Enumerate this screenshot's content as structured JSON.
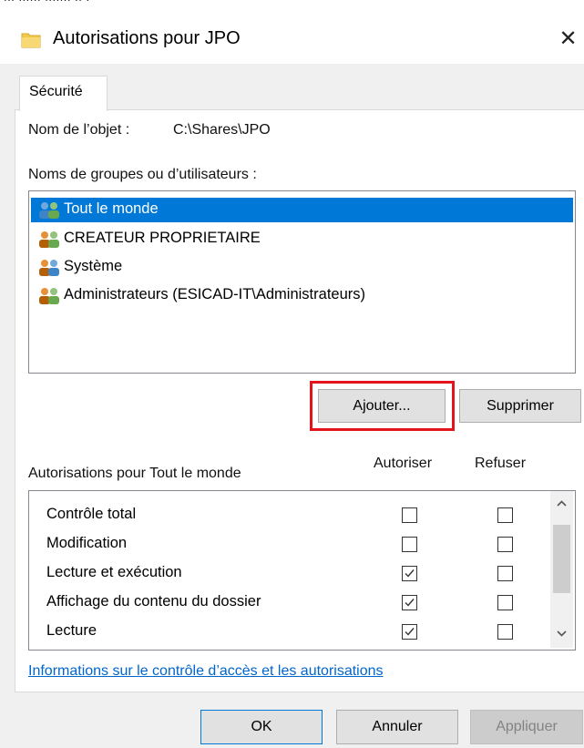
{
  "window": {
    "cropped_top_text": "... ......  ....... .. .",
    "title": "Autorisations pour JPO",
    "close_glyph": "✕"
  },
  "tabs": [
    {
      "label": "Sécurité",
      "active": true
    }
  ],
  "object": {
    "label": "Nom de l’objet :",
    "value": "C:\\Shares\\JPO"
  },
  "groups": {
    "label": "Noms de groupes ou d’utilisateurs :",
    "items": [
      {
        "label": "Tout le monde",
        "icon": "users-icon",
        "selected": true
      },
      {
        "label": "CREATEUR PROPRIETAIRE",
        "icon": "users-icon",
        "selected": false
      },
      {
        "label": "Système",
        "icon": "users-icon",
        "selected": false
      },
      {
        "label": "Administrateurs (ESICAD-IT\\Administrateurs)",
        "icon": "users-icon",
        "selected": false
      }
    ]
  },
  "group_buttons": {
    "add": "Ajouter...",
    "remove": "Supprimer",
    "highlight_color": "#e3141c"
  },
  "permissions": {
    "label": "Autorisations pour Tout le monde",
    "allow_header": "Autoriser",
    "deny_header": "Refuser",
    "rows": [
      {
        "name": "Contrôle total",
        "allow": false,
        "deny": false
      },
      {
        "name": "Modification",
        "allow": false,
        "deny": false
      },
      {
        "name": "Lecture et exécution",
        "allow": true,
        "deny": false
      },
      {
        "name": "Affichage du contenu du dossier",
        "allow": true,
        "deny": false
      },
      {
        "name": "Lecture",
        "allow": true,
        "deny": false
      }
    ]
  },
  "info_link": "Informations sur le contrôle d’accès et les autorisations",
  "footer_buttons": {
    "ok": "OK",
    "cancel": "Annuler",
    "apply": "Appliquer"
  },
  "colors": {
    "selection": "#0078d7",
    "link": "#0066cc",
    "dialog_bg": "#f0f0f0"
  }
}
